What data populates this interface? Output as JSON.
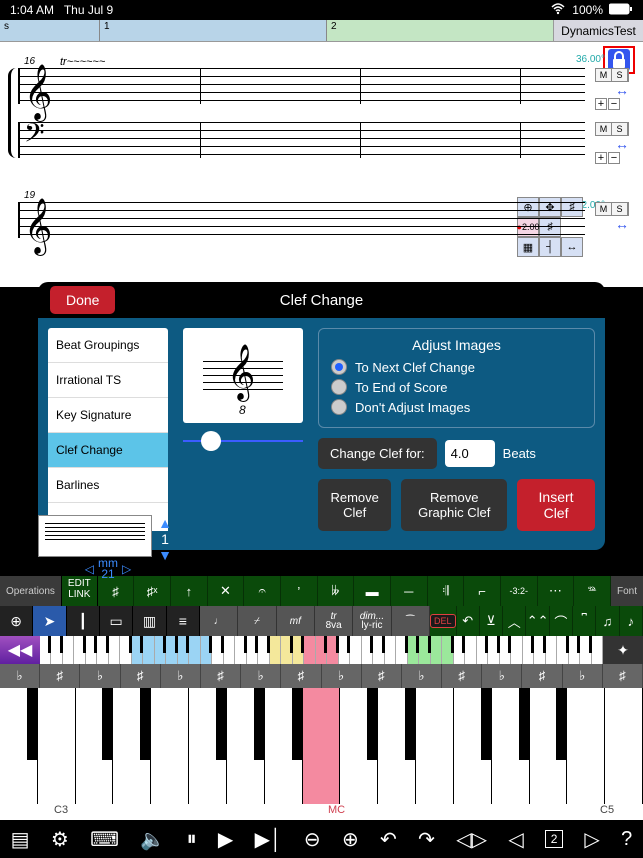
{
  "status": {
    "time": "1:04 AM",
    "date": "Thu Jul 9",
    "battery": "100%"
  },
  "ruler": {
    "seg1": "s",
    "seg2": "1",
    "seg3": "2",
    "project": "DynamicsTest"
  },
  "score": {
    "m1": "16",
    "m2": "19",
    "deg1": "36.00°",
    "deg2": "42.00°",
    "ctrl": {
      "m": "M",
      "s": "S",
      "plus": "+",
      "minus": "−",
      "arr": "↔"
    },
    "cluster": {
      "val": "2.00",
      "rec": "●"
    }
  },
  "dialog": {
    "done": "Done",
    "title": "Clef Change",
    "menu": [
      "Beat Groupings",
      "Irrational TS",
      "Key Signature",
      "Clef Change",
      "Barlines"
    ],
    "menu_sel": 3,
    "adjust": {
      "hdr": "Adjust Images",
      "opts": [
        "To Next Clef Change",
        "To End of Score",
        "Don't Adjust Images"
      ],
      "sel": 0
    },
    "change_for": "Change Clef for:",
    "beats_val": "4.0",
    "beats_lbl": "Beats",
    "remove": "Remove Clef",
    "remove_g": "Remove Graphic Clef",
    "insert": "Insert Clef",
    "nav_num": "1",
    "nav_mm": "mm",
    "nav_meas": "21"
  },
  "ops": {
    "label": "Operations",
    "edit": "EDIT",
    "link": "LINK",
    "font": "Font"
  },
  "row2": {
    "dyn": "mf",
    "oct": "8va",
    "tr": "tr",
    "dim": "dim...",
    "lyr": "ly-ric",
    "del": "DEL"
  },
  "kb": {
    "c3": "C3",
    "mc": "MC",
    "c5": "C5"
  },
  "bottom": {
    "page": "2"
  },
  "accidentals": [
    "♭",
    "♯",
    "♭",
    "♯",
    "♭",
    "♯",
    "♭",
    "♯",
    "♭",
    "♯",
    "♭",
    "♯",
    "♭",
    "♯",
    "♭",
    "♯"
  ]
}
